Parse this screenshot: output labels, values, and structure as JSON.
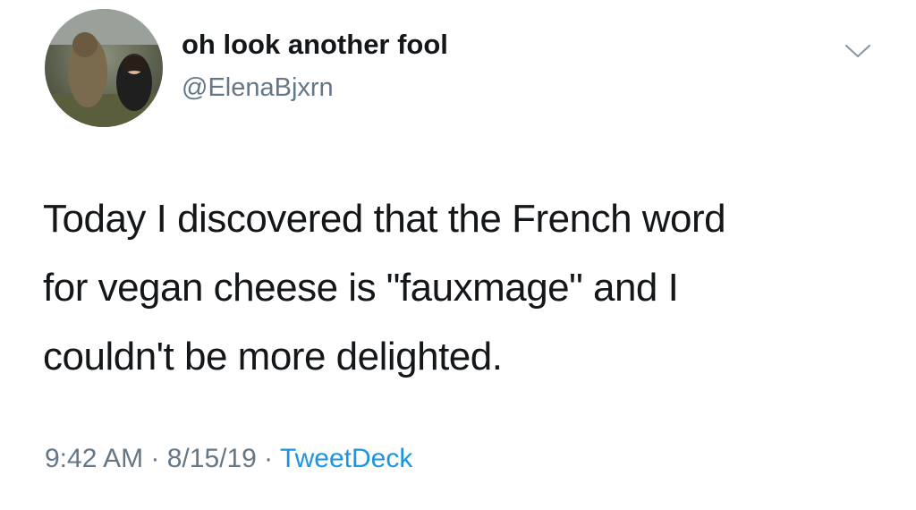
{
  "tweet": {
    "display_name": "oh look another fool",
    "handle": "@ElenaBjxrn",
    "text": "Today I discovered that the French word\nfor vegan cheese is \"fauxmage\" and I\ncouldn't be more delighted.",
    "time": "9:42 AM",
    "separator": " · ",
    "date": "8/15/19",
    "source": "TweetDeck",
    "source_color": "#1b95e0",
    "menu_icon": "chevron-down-icon"
  }
}
